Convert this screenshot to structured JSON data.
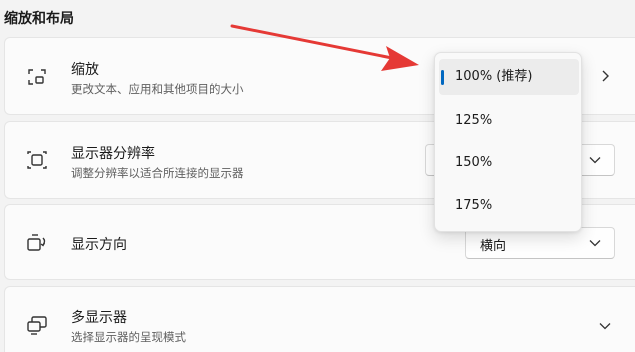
{
  "section": {
    "title": "缩放和布局"
  },
  "scale": {
    "title": "缩放",
    "subtitle": "更改文本、应用和其他项目的大小",
    "icon": "scale-icon"
  },
  "resolution": {
    "title": "显示器分辨率",
    "subtitle": "调整分辨率以适合所连接的显示器",
    "icon": "resolution-icon"
  },
  "orientation": {
    "title": "显示方向",
    "value": "横向",
    "icon": "orientation-icon"
  },
  "multi_display": {
    "title": "多显示器",
    "subtitle": "选择显示器的呈现模式",
    "icon": "multi-display-icon"
  },
  "scale_dropdown": {
    "options": [
      "100% (推荐)",
      "125%",
      "150%",
      "175%"
    ],
    "selected_index": 0
  },
  "colors": {
    "accent": "#0067c0",
    "annotation_arrow": "#e53935"
  }
}
